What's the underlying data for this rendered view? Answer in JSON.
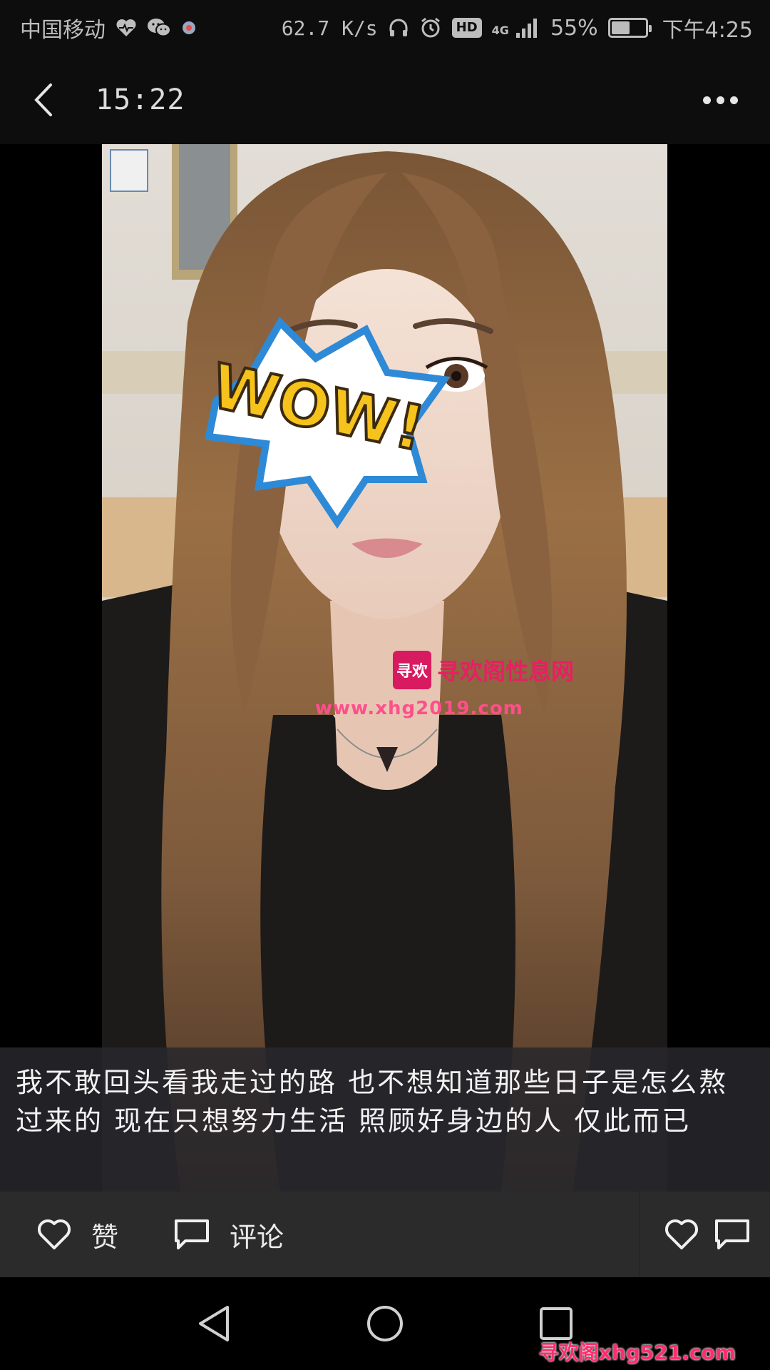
{
  "status_bar": {
    "carrier": "中国移动",
    "net_speed": "62.7 K/s",
    "hd": "HD",
    "network_type": "4G",
    "battery_percent": "55%",
    "battery_level": 0.55,
    "time": "下午4:25"
  },
  "header": {
    "title": "15:22"
  },
  "photo": {
    "sticker_text": "WOW!",
    "watermark_title": "寻欢阁性息网",
    "watermark_logo": "寻欢",
    "watermark_url": "www.xhg2019.com"
  },
  "caption": {
    "text": "我不敢回头看我走过的路 也不想知道那些日子是怎么熬过来的 现在只想努力生活 照顾好身边的人 仅此而已"
  },
  "actions": {
    "like_label": "赞",
    "comment_label": "评论"
  },
  "corner_watermark": "寻欢阁xhg521.com"
}
